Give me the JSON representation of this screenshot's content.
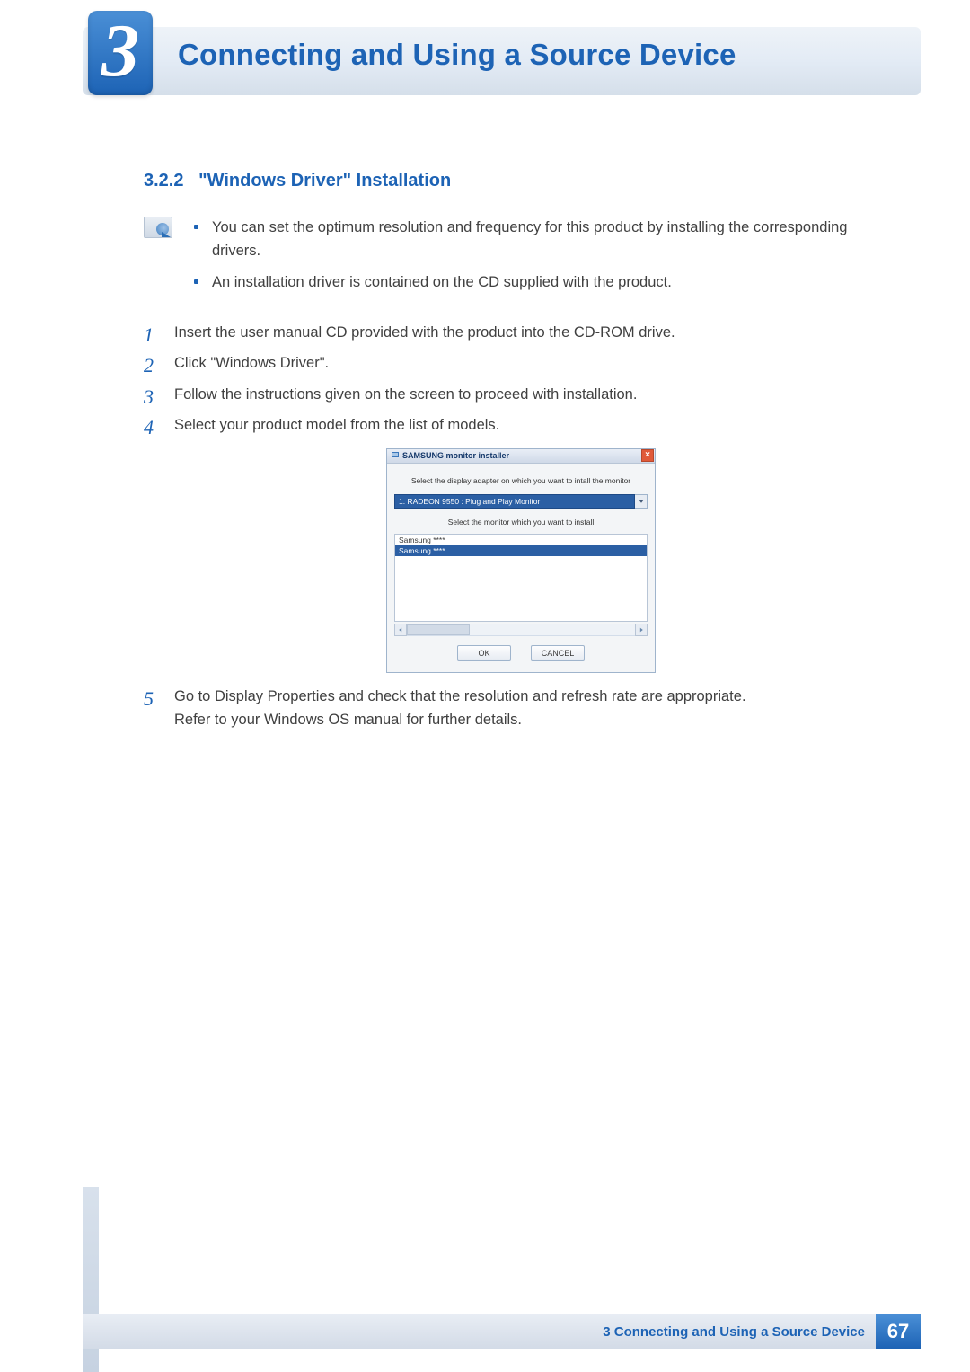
{
  "chapter": {
    "number": "3",
    "title": "Connecting and Using a Source Device"
  },
  "section": {
    "number": "3.2.2",
    "title": "\"Windows Driver\" Installation"
  },
  "notes": {
    "items": [
      "You can set the optimum resolution and frequency for this product by installing the corresponding drivers.",
      "An installation driver is contained on the CD supplied with the product."
    ]
  },
  "steps": {
    "n1": "1",
    "s1": "Insert the user manual CD provided with the product into the CD-ROM drive.",
    "n2": "2",
    "s2": "Click \"Windows Driver\".",
    "n3": "3",
    "s3": "Follow the instructions given on the screen to proceed with installation.",
    "n4": "4",
    "s4": "Select your product model from the list of models.",
    "n5": "5",
    "s5a": "Go to Display Properties and check that the resolution and refresh rate are appropriate.",
    "s5b": "Refer to your Windows OS manual for further details."
  },
  "dialog": {
    "title": "SAMSUNG monitor installer",
    "instruction1": "Select the display adapter on which you want to intall the monitor",
    "adapter_selected": "1. RADEON 9550 : Plug and Play Monitor",
    "instruction2": "Select the monitor which you want to install",
    "list": {
      "row1": "Samsung ****",
      "row2_selected": "Samsung ****"
    },
    "ok": "OK",
    "cancel": "CANCEL"
  },
  "footer": {
    "label": "3 Connecting and Using a Source Device",
    "page": "67"
  }
}
